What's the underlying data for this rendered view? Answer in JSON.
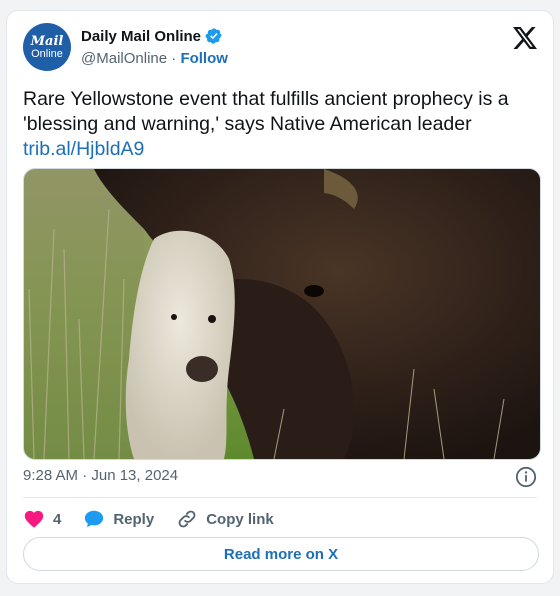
{
  "author": {
    "display_name": "Daily Mail Online",
    "handle": "@MailOnline",
    "separator": "·",
    "follow_label": "Follow",
    "avatar_line1": "Mail",
    "avatar_line2": "Online",
    "avatar_color": "#1f5fa8",
    "verified_icon": "verified-badge-icon"
  },
  "platform_icon": "x-logo-icon",
  "tweet": {
    "text": "Rare Yellowstone event that fulfills ancient prophecy is a 'blessing and warning,' says Native American leader",
    "link": "trib.al/HjbldA9"
  },
  "media": {
    "icon": "photo-bison-and-white-calf"
  },
  "meta": {
    "timestamp": "9:28 AM · Jun 13, 2024",
    "info_icon": "info-icon"
  },
  "actions": {
    "like_count": "4",
    "reply_label": "Reply",
    "copy_label": "Copy link"
  },
  "read_more_label": "Read more on X",
  "colors": {
    "accent": "#1d6fb8",
    "like": "#f91880",
    "reply": "#1d9bf0",
    "muted": "#536471"
  }
}
